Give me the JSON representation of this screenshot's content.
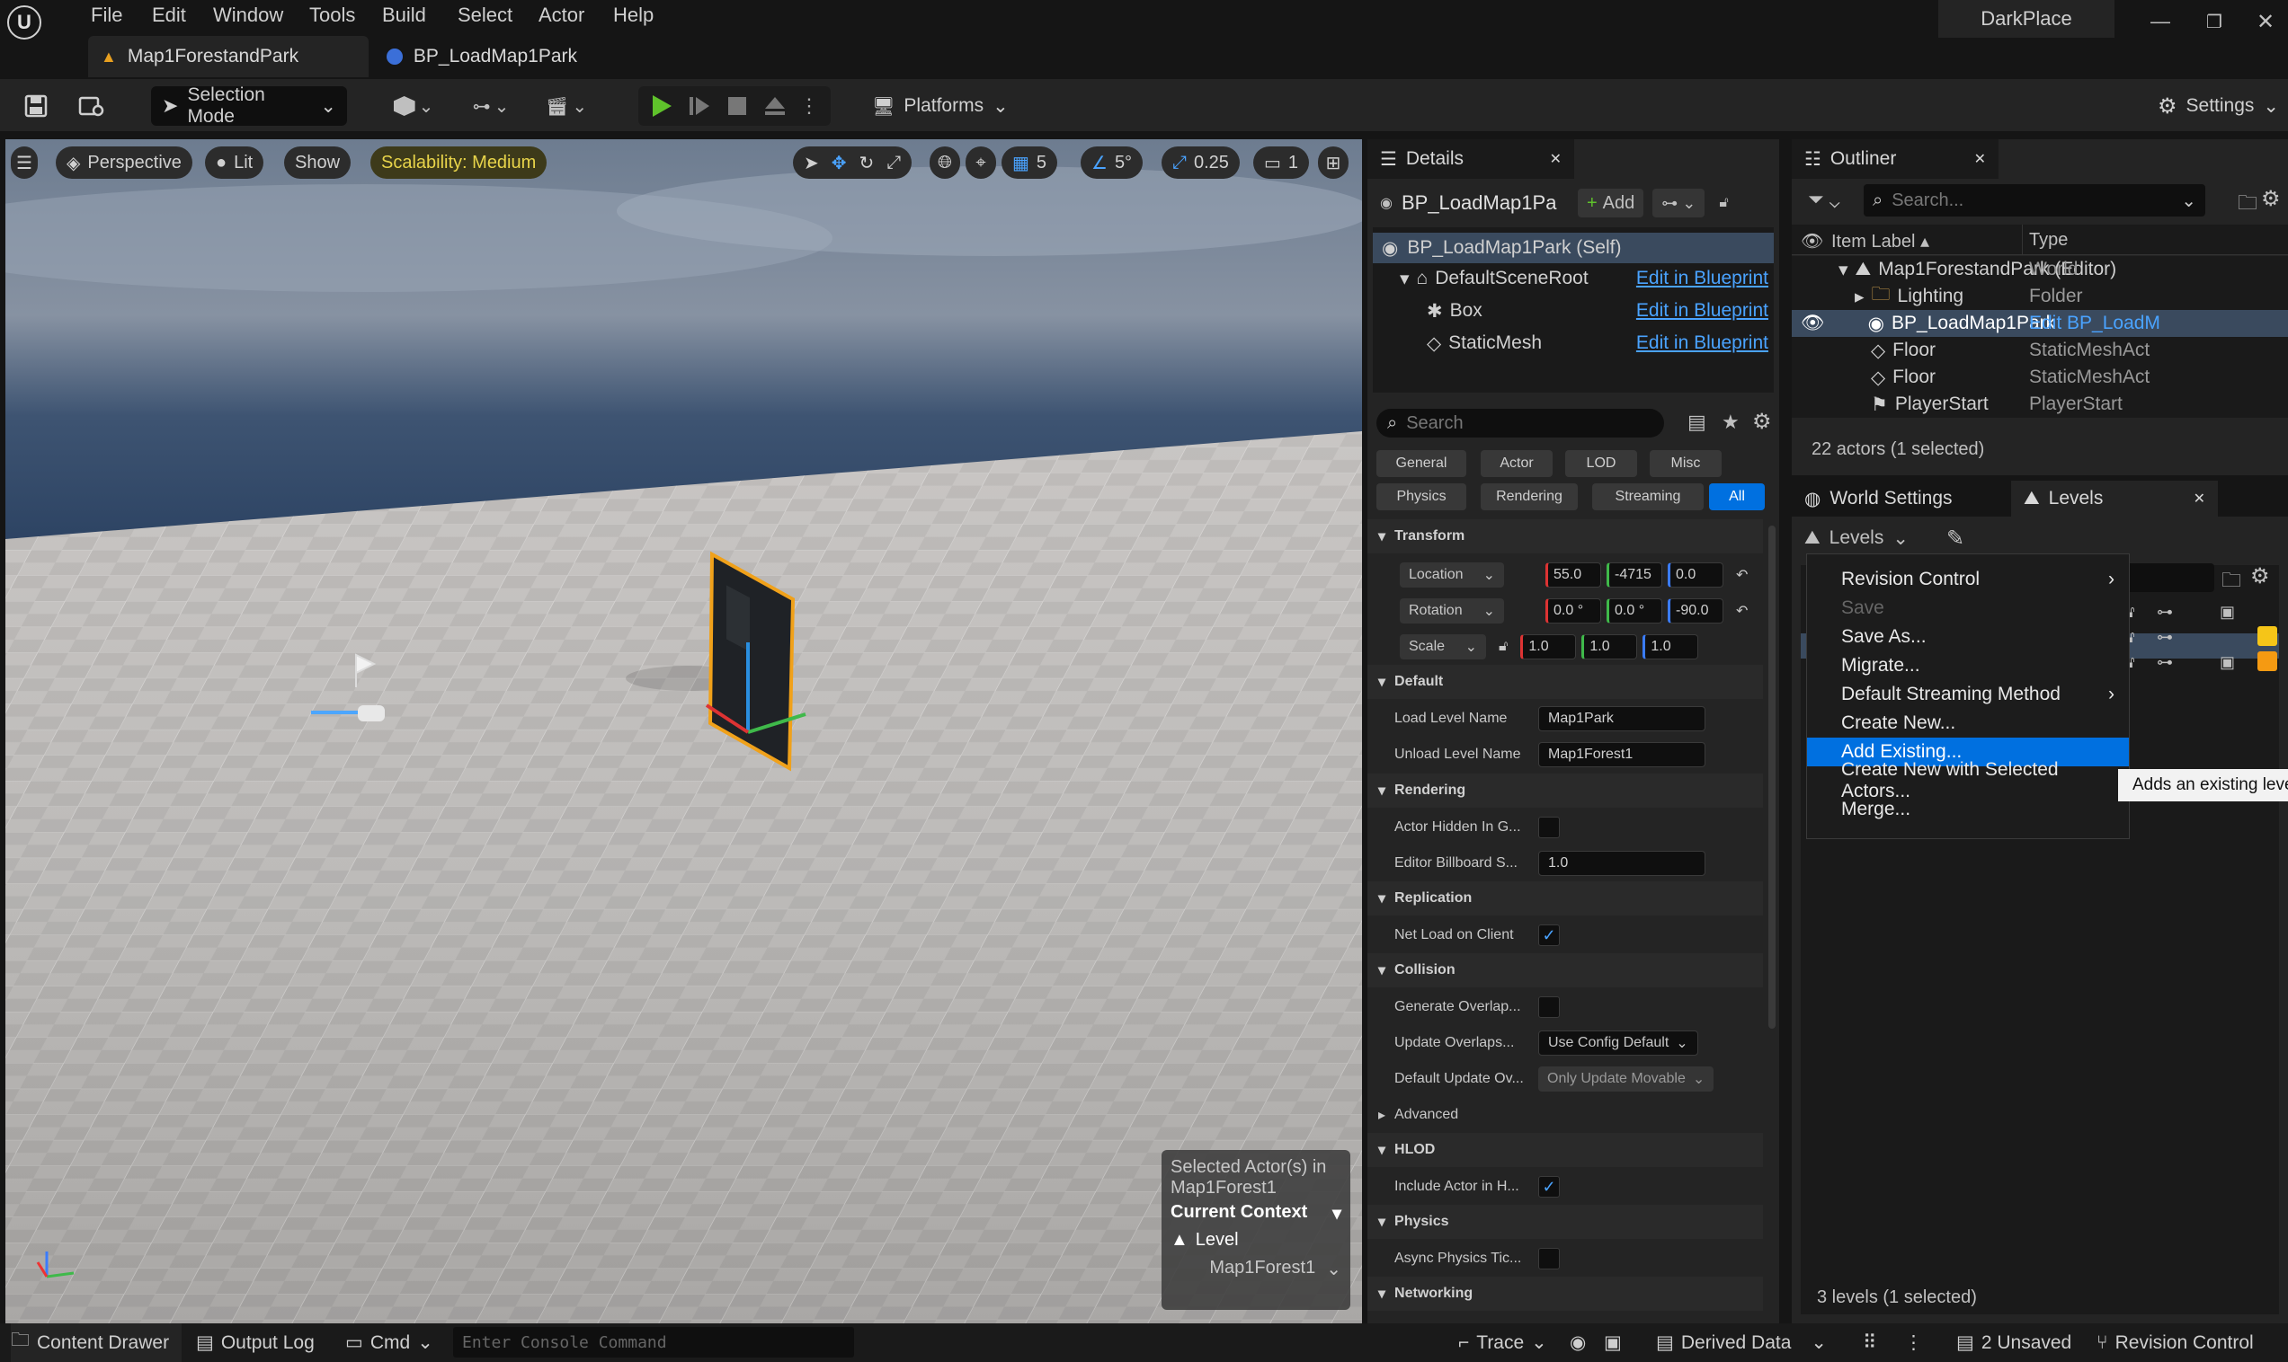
{
  "app": {
    "project_name": "DarkPlace"
  },
  "menu": [
    "File",
    "Edit",
    "Window",
    "Tools",
    "Build",
    "Select",
    "Actor",
    "Help"
  ],
  "tabs": [
    {
      "label": "Map1ForestandPark"
    },
    {
      "label": "BP_LoadMap1Park"
    }
  ],
  "toolbar": {
    "mode_label": "Selection Mode",
    "platforms_label": "Platforms",
    "settings_label": "Settings"
  },
  "viewport": {
    "perspective_label": "Perspective",
    "lit_label": "Lit",
    "show_label": "Show",
    "scalability_label": "Scalability: Medium",
    "grid_value": "5",
    "angle_value": "5°",
    "scale_value": "0.25",
    "camera_speed": "1",
    "context": {
      "selected_text": "Selected Actor(s) in",
      "level_name": "Map1Forest1",
      "title": "Current Context",
      "level_label": "Level",
      "level_value": "Map1Forest1"
    }
  },
  "details": {
    "tab_label": "Details",
    "actor_name": "BP_LoadMap1Pa",
    "add_label": "Add",
    "components": [
      {
        "label": "BP_LoadMap1Park (Self)",
        "link": ""
      },
      {
        "label": "DefaultSceneRoot",
        "link": "Edit in Blueprint"
      },
      {
        "label": "Box",
        "link": "Edit in Blueprint"
      },
      {
        "label": "StaticMesh",
        "link": "Edit in Blueprint"
      }
    ],
    "search_placeholder": "Search",
    "categories": [
      "General",
      "Actor",
      "LOD",
      "Misc",
      "Physics",
      "Rendering",
      "Streaming",
      "All"
    ],
    "sections": {
      "transform": "Transform",
      "default": "Default",
      "rendering": "Rendering",
      "replication": "Replication",
      "collision": "Collision",
      "advanced": "Advanced",
      "hlod": "HLOD",
      "physics": "Physics",
      "networking": "Networking"
    },
    "transform": {
      "location_label": "Location",
      "location": [
        "55.0",
        "-4715",
        "0.0"
      ],
      "rotation_label": "Rotation",
      "rotation": [
        "0.0 °",
        "0.0 °",
        "-90.0"
      ],
      "scale_label": "Scale",
      "scale": [
        "1.0",
        "1.0",
        "1.0"
      ]
    },
    "props": {
      "load_level_label": "Load Level Name",
      "load_level_value": "Map1Park",
      "unload_level_label": "Unload Level Name",
      "unload_level_value": "Map1Forest1",
      "actor_hidden_label": "Actor Hidden In G...",
      "billboard_label": "Editor Billboard S...",
      "billboard_value": "1.0",
      "net_load_label": "Net Load on Client",
      "gen_overlap_label": "Generate Overlap...",
      "update_overlaps_label": "Update Overlaps...",
      "update_overlaps_value": "Use Config Default",
      "default_update_label": "Default Update Ov...",
      "default_update_value": "Only Update Movable",
      "include_actor_label": "Include Actor in H...",
      "async_physics_label": "Async Physics Tic..."
    }
  },
  "outliner": {
    "tab_label": "Outliner",
    "search_placeholder": "Search...",
    "col_label": "Item Label",
    "col_type": "Type",
    "rows": [
      {
        "label": "Map1ForestandPark (Editor)",
        "type": "World"
      },
      {
        "label": "Lighting",
        "type": "Folder"
      },
      {
        "label": "BP_LoadMap1Park",
        "type": "Edit BP_LoadM"
      },
      {
        "label": "Floor",
        "type": "StaticMeshAct"
      },
      {
        "label": "Floor",
        "type": "StaticMeshAct"
      },
      {
        "label": "PlayerStart",
        "type": "PlayerStart"
      }
    ],
    "count": "22 actors (1 selected)"
  },
  "levels": {
    "world_settings_tab": "World Settings",
    "levels_tab": "Levels",
    "levels_dropdown": "Levels",
    "count": "3 levels (1 selected)",
    "menu": [
      {
        "label": "Revision Control",
        "sub": true
      },
      {
        "label": "Save",
        "disabled": true
      },
      {
        "label": "Save As..."
      },
      {
        "label": "Migrate..."
      },
      {
        "label": "Default Streaming Method",
        "sub": true
      },
      {
        "label": "Create New..."
      },
      {
        "label": "Add Existing...",
        "highlight": true
      },
      {
        "label": "Create New with Selected Actors..."
      },
      {
        "label": "Merge..."
      }
    ],
    "tooltip": "Adds an existing level",
    "colors": {
      "yellow": "#f5c518",
      "orange": "#f59a12"
    }
  },
  "status": {
    "content_drawer": "Content Drawer",
    "output_log": "Output Log",
    "cmd": "Cmd",
    "console_placeholder": "Enter Console Command",
    "trace": "Trace",
    "derived_data": "Derived Data",
    "unsaved": "2 Unsaved",
    "revision_control": "Revision Control"
  },
  "colors": {
    "accent": "#0070e0",
    "link": "#4aa3ff",
    "play_green": "#5fc22b",
    "scalability_bg": "#3d3a1a",
    "scalability_text": "#e8d44a"
  }
}
